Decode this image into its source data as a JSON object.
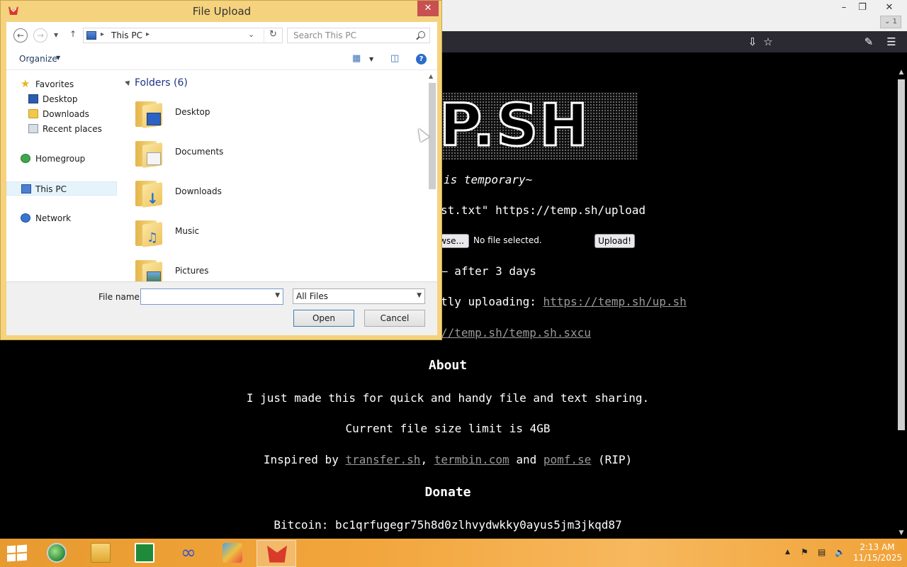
{
  "browser": {
    "tab_count": "1",
    "page": {
      "logo": "P.SH",
      "tagline": "is temporary~",
      "curl_line": "st.txt\" https://temp.sh/upload",
      "browse_label": "wse...",
      "no_file": "No file selected.",
      "upload_label": "Upload!",
      "expire_line": "after 3 days",
      "script_prefix": "tly uploading:",
      "script_link": "https://temp.sh/up.sh",
      "sxcu_link": "//temp.sh/temp.sh.sxcu",
      "about_heading": "About",
      "about_text": "I just made this for quick and handy file and text sharing.",
      "limit_text": "Current file size limit is 4GB",
      "inspired_prefix": "Inspired by",
      "inspired_link1": "transfer.sh",
      "inspired_comma": ",",
      "inspired_link2": "termbin.com",
      "inspired_and": "and",
      "inspired_link3": "pomf.se",
      "inspired_suffix": "(RIP)",
      "donate_heading": "Donate",
      "bitcoin_text": "Bitcoin: bc1qrfugegr75h8d0zlhvydwkky0ayus5jm3jkqd87"
    }
  },
  "dialog": {
    "title": "File Upload",
    "address": "This PC",
    "search_placeholder": "Search This PC",
    "organize_label": "Organize",
    "nav": {
      "favorites": "Favorites",
      "desktop": "Desktop",
      "downloads": "Downloads",
      "recent": "Recent places",
      "homegroup": "Homegroup",
      "thispc": "This PC",
      "network": "Network"
    },
    "group_header": "Folders (6)",
    "folders": [
      "Desktop",
      "Documents",
      "Downloads",
      "Music",
      "Pictures"
    ],
    "file_name_label": "File name:",
    "file_name_value": "",
    "file_type": "All Files",
    "open_label": "Open",
    "cancel_label": "Cancel"
  },
  "taskbar": {
    "time": "2:13 AM",
    "date": "11/15/2025"
  },
  "colors": {
    "dialog_frame": "#f5d37e",
    "taskbar": "#f2a53c",
    "link_gray": "#9a9a9a"
  }
}
